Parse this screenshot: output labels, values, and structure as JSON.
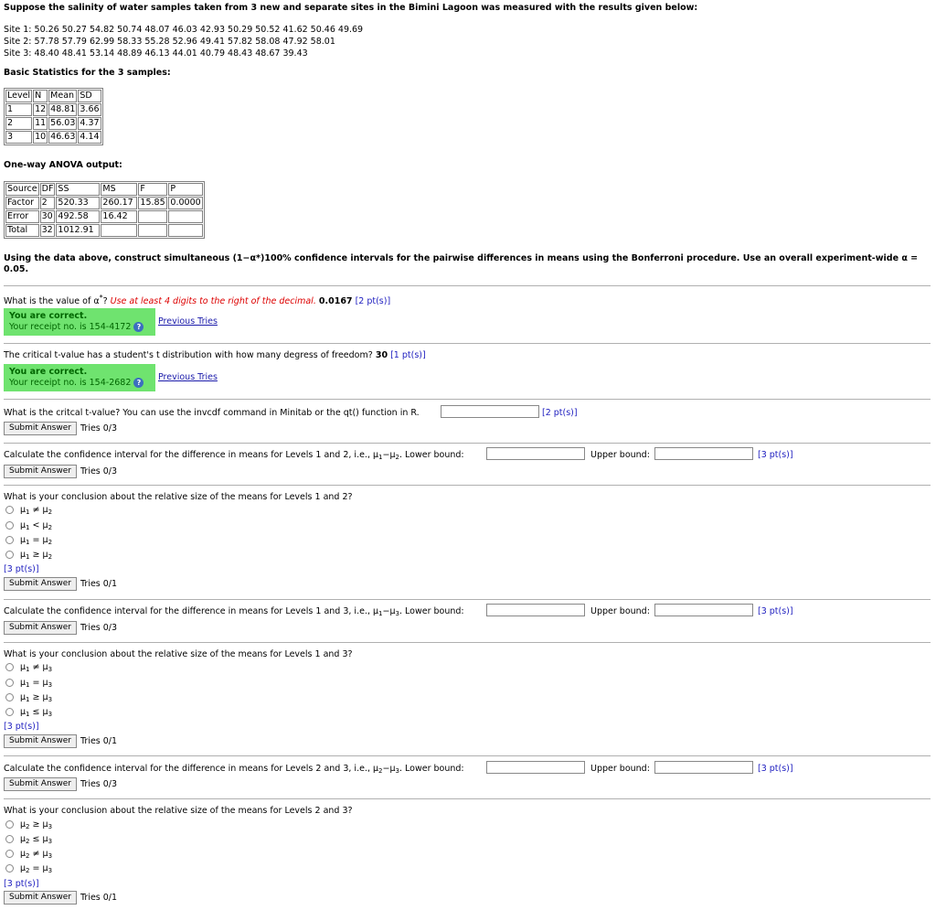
{
  "intro": "Suppose the salinity of water samples taken from 3 new and separate sites in the Bimini Lagoon was measured with the results given below:",
  "sites": [
    "Site 1: 50.26 50.27 54.82 50.74 48.07 46.03 42.93 50.29 50.52 41.62 50.46 49.69",
    "Site 2: 57.78 57.79 62.99 58.33 55.28 52.96 49.41 57.82 58.08 47.92 58.01",
    "Site 3: 48.40 48.41 53.14 48.89 46.13 44.01 40.79 48.43 48.67 39.43"
  ],
  "basic_header": "Basic Statistics for the 3 samples:",
  "basic_table": {
    "headers": [
      "Level",
      "N",
      "Mean",
      "SD"
    ],
    "rows": [
      [
        "1",
        "12",
        "48.81",
        "3.66"
      ],
      [
        "2",
        "11",
        "56.03",
        "4.37"
      ],
      [
        "3",
        "10",
        "46.63",
        "4.14"
      ]
    ]
  },
  "anova_header": "One-way ANOVA output:",
  "anova_table": {
    "headers": [
      "Source",
      "DF",
      "SS",
      "MS",
      "F",
      "P"
    ],
    "rows": [
      [
        "Factor",
        "2",
        "520.33",
        "260.17",
        "15.85",
        "0.0000"
      ],
      [
        "Error",
        "30",
        "492.58",
        "16.42",
        "",
        ""
      ],
      [
        "Total",
        "32",
        "1012.91",
        "",
        "",
        ""
      ]
    ]
  },
  "instruction": "Using the data above, construct simultaneous (1−α*)100% confidence intervals for the pairwise differences in means using the Bonferroni procedure. Use an overall experiment-wide α = 0.05.",
  "q1": {
    "text": "What is the value of α",
    "sup": "*",
    "text2": "?",
    "hint": "Use at least 4 digits to the right of the decimal.",
    "answer": "0.0167",
    "points": "[2 pt(s)]",
    "correct": "You are correct.",
    "receipt": "Your receipt no. is 154-4172",
    "prev": "Previous Tries"
  },
  "q2": {
    "text": "The critical t-value has a student's t distribution with how many degress of freedom?",
    "answer": "30",
    "points": "[1 pt(s)]",
    "correct": "You are correct.",
    "receipt": "Your receipt no. is 154-2682",
    "prev": "Previous Tries"
  },
  "q3": {
    "text": "What is the critcal t-value? You can use the invcdf command in Minitab or the qt() function in R.",
    "points": "[2 pt(s)]",
    "submit": "Submit Answer",
    "tries": "Tries 0/3"
  },
  "q4": {
    "text": "Calculate the confidence interval for the difference in means for Levels 1 and 2, i.e., μ",
    "a": "1",
    "b": "2",
    "lower": "Lower bound:",
    "upper": "Upper bound:",
    "points": "[3 pt(s)]",
    "submit": "Submit Answer",
    "tries": "Tries 0/3"
  },
  "q5": {
    "text": "What is your conclusion about the relative size of the means for Levels 1 and 2?",
    "options": [
      "≠",
      "<",
      "=",
      "≥"
    ],
    "a": "1",
    "b": "2",
    "points": "[3 pt(s)]",
    "submit": "Submit Answer",
    "tries": "Tries 0/1"
  },
  "q6": {
    "text": "Calculate the confidence interval for the difference in means for Levels 1 and 3, i.e., μ",
    "a": "1",
    "b": "3",
    "lower": "Lower bound:",
    "upper": "Upper bound:",
    "points": "[3 pt(s)]",
    "submit": "Submit Answer",
    "tries": "Tries 0/3"
  },
  "q7": {
    "text": "What is your conclusion about the relative size of the means for Levels 1 and 3?",
    "options": [
      "≠",
      "=",
      "≥",
      "≤"
    ],
    "a": "1",
    "b": "3",
    "points": "[3 pt(s)]",
    "submit": "Submit Answer",
    "tries": "Tries 0/1"
  },
  "q8": {
    "text": "Calculate the confidence interval for the difference in means for Levels 2 and 3, i.e., μ",
    "a": "2",
    "b": "3",
    "lower": "Lower bound:",
    "upper": "Upper bound:",
    "points": "[3 pt(s)]",
    "submit": "Submit Answer",
    "tries": "Tries 0/3"
  },
  "q9": {
    "text": "What is your conclusion about the relative size of the means for Levels 2 and 3?",
    "options": [
      "≥",
      "≤",
      "≠",
      "="
    ],
    "a": "2",
    "b": "3",
    "points": "[3 pt(s)]",
    "submit": "Submit Answer",
    "tries": "Tries 0/1"
  },
  "colors": {
    "correct_bg": "#6fe36f",
    "link": "#1a1aaa",
    "hint": "#dd0000",
    "points": "#2020c0"
  }
}
